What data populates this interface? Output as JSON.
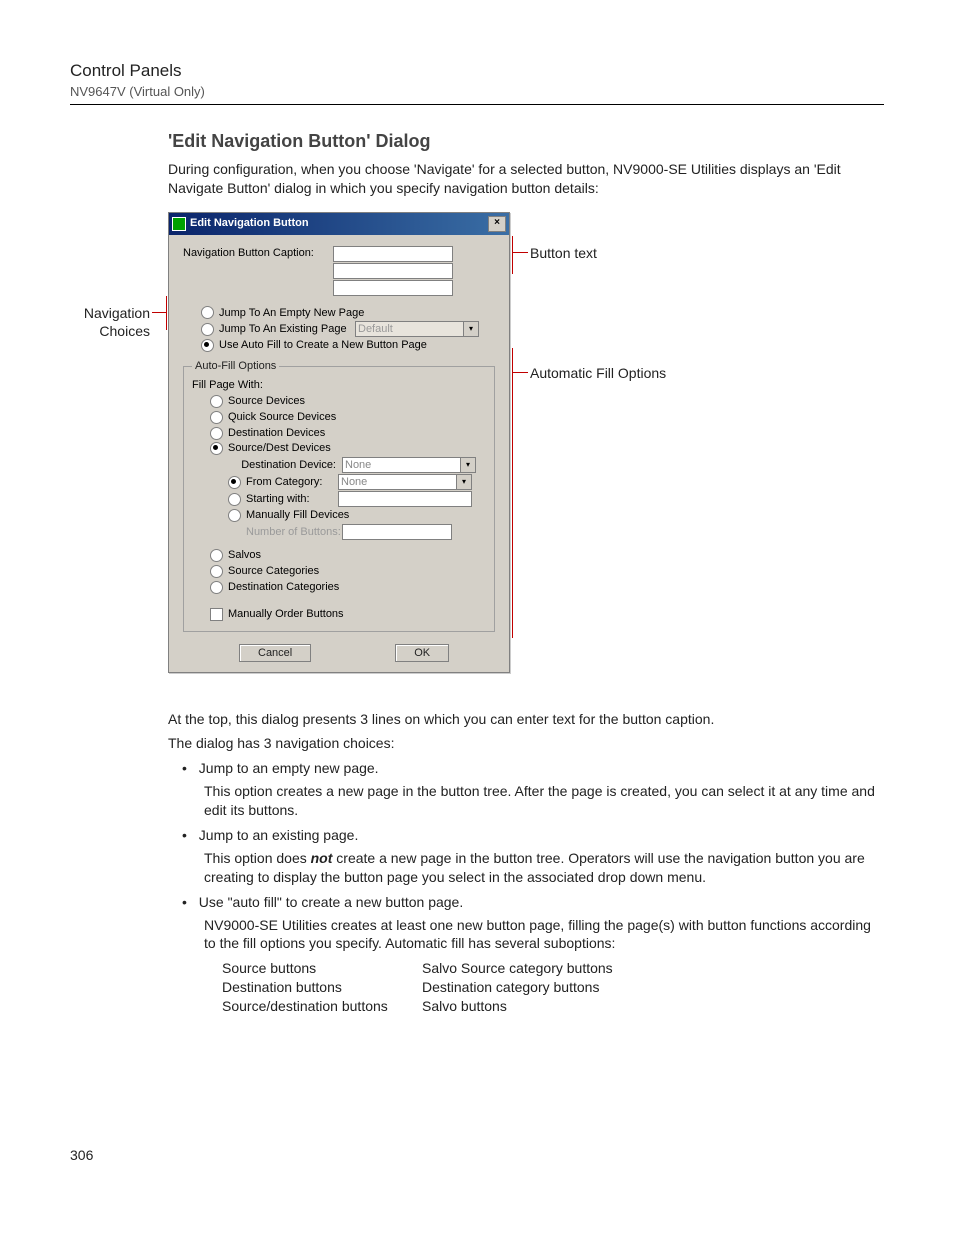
{
  "header": {
    "title": "Control Panels",
    "subtitle": "NV9647V (Virtual Only)"
  },
  "section_heading": "'Edit Navigation Button' Dialog",
  "intro": "During configuration, when you choose 'Navigate' for a selected button, NV9000-SE Utilities displays an 'Edit Navigate Button' dialog in which you specify navigation button details:",
  "callouts": {
    "nav_choices": "Navigation Choices",
    "button_text": "Button text",
    "auto_fill": "Automatic Fill Options"
  },
  "dialog": {
    "title": "Edit Navigation Button",
    "caption_label": "Navigation Button Caption:",
    "nav_opts": {
      "jump_empty": "Jump To An Empty New Page",
      "jump_existing": "Jump To An Existing Page",
      "existing_combo": "Default",
      "use_autofill": "Use Auto Fill to Create a New Button Page"
    },
    "autofill_legend": "Auto-Fill Options",
    "fill_with": "Fill Page With:",
    "fill_opts": {
      "source": "Source Devices",
      "quick": "Quick Source Devices",
      "dest": "Destination Devices",
      "srcdest": "Source/Dest Devices",
      "dest_device_lbl": "Destination Device:",
      "dest_device_val": "None",
      "from_cat": "From Category:",
      "from_cat_val": "None",
      "starting": "Starting with:",
      "manual_fill": "Manually Fill Devices",
      "num_buttons": "Number of Buttons:",
      "salvos": "Salvos",
      "src_cat": "Source Categories",
      "dst_cat": "Destination Categories",
      "manual_order": "Manually Order Buttons"
    },
    "cancel": "Cancel",
    "ok": "OK"
  },
  "body": {
    "p1": "At the top, this dialog presents 3 lines on which you can enter text for the button caption.",
    "p2": "The dialog has 3 navigation choices:",
    "b1": "Jump to an empty new page.",
    "b1_sub": "This option creates a new page in the button tree. After the page is created, you can select it at any time and edit its buttons.",
    "b2": "Jump to an existing page.",
    "b2_sub_pre": "This option does ",
    "b2_sub_em": "not",
    "b2_sub_post": " create a new page in the button tree. Operators will use the navigation button you are creating to display the button page you select in the associated drop down menu.",
    "b3": "Use \"auto fill\" to create a new button page.",
    "b3_sub": "NV9000-SE Utilities creates at least one new button page, filling the page(s) with button functions according to the fill options you specify. Automatic fill has several suboptions:",
    "colA": [
      "Source buttons",
      "Destination buttons",
      "Source/destination buttons"
    ],
    "colB": [
      "Salvo Source category buttons",
      "Destination category buttons",
      "Salvo buttons"
    ]
  },
  "page_num": "306"
}
